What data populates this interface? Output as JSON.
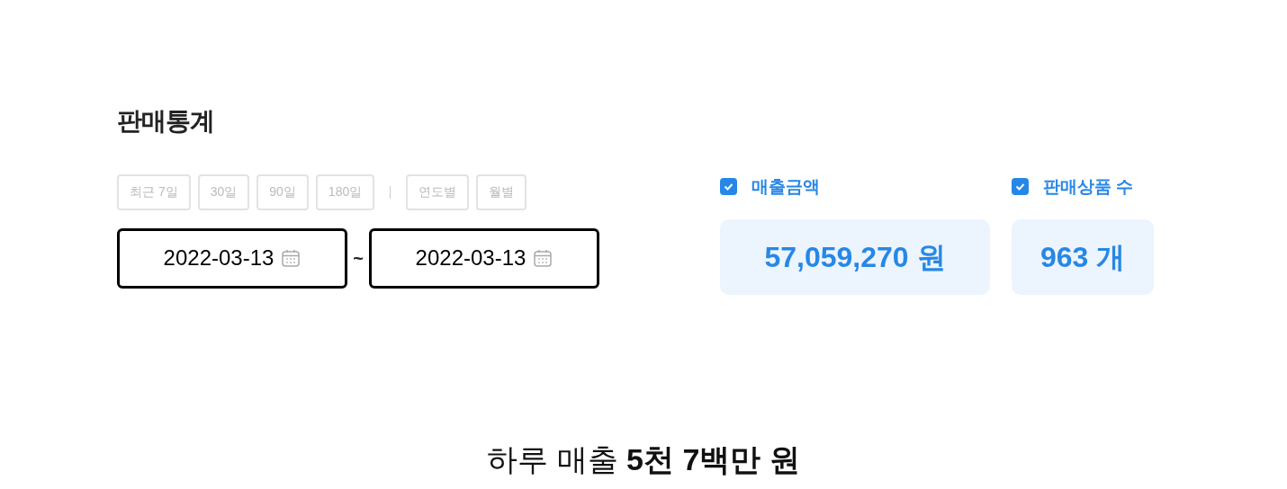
{
  "title": "판매통계",
  "period_buttons": [
    {
      "label": "최근 7일",
      "disabled": true
    },
    {
      "label": "30일",
      "disabled": true
    },
    {
      "label": "90일",
      "disabled": true
    },
    {
      "label": "180일",
      "disabled": true
    }
  ],
  "group_buttons": [
    {
      "label": "연도별",
      "disabled": true
    },
    {
      "label": "월별",
      "disabled": true
    }
  ],
  "date_range": {
    "start": "2022-03-13",
    "separator": "~",
    "end": "2022-03-13"
  },
  "metrics": [
    {
      "label": "매출금액",
      "checked": true,
      "value": "57,059,270 원"
    },
    {
      "label": "판매상품 수",
      "checked": true,
      "value": "963 개"
    }
  ],
  "summary": "하루 매출 **5천 7백만 원**"
}
